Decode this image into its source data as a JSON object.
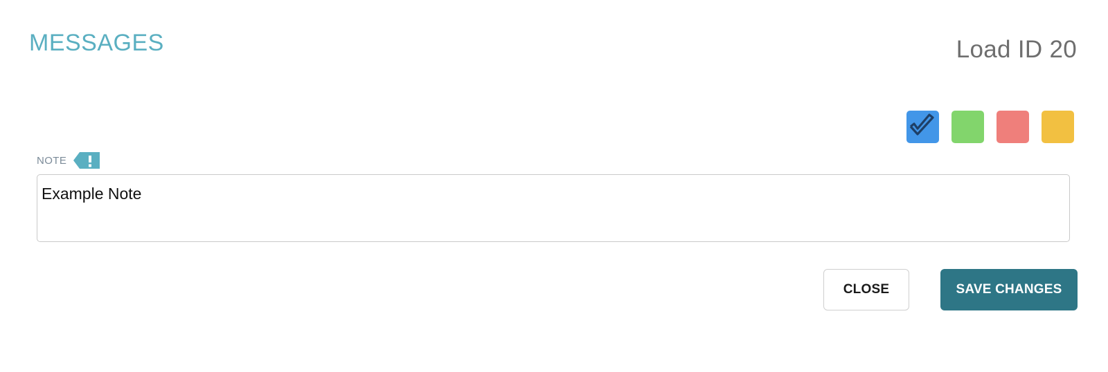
{
  "modal": {
    "title": "MESSAGES",
    "load_id": "Load ID 20"
  },
  "color_picker": {
    "swatches": [
      {
        "name": "blue",
        "color": "#4296e8",
        "selected": true
      },
      {
        "name": "green",
        "color": "#82d56c",
        "selected": false
      },
      {
        "name": "red",
        "color": "#ef7f7b",
        "selected": false
      },
      {
        "name": "yellow",
        "color": "#f2c041",
        "selected": false
      }
    ]
  },
  "note": {
    "label": "NOTE",
    "flag_icon": "exclamation-flag-icon",
    "flag_color": "#5aafc1",
    "value": "Example Note"
  },
  "buttons": {
    "close_label": "CLOSE",
    "save_label": "SAVE CHANGES"
  }
}
